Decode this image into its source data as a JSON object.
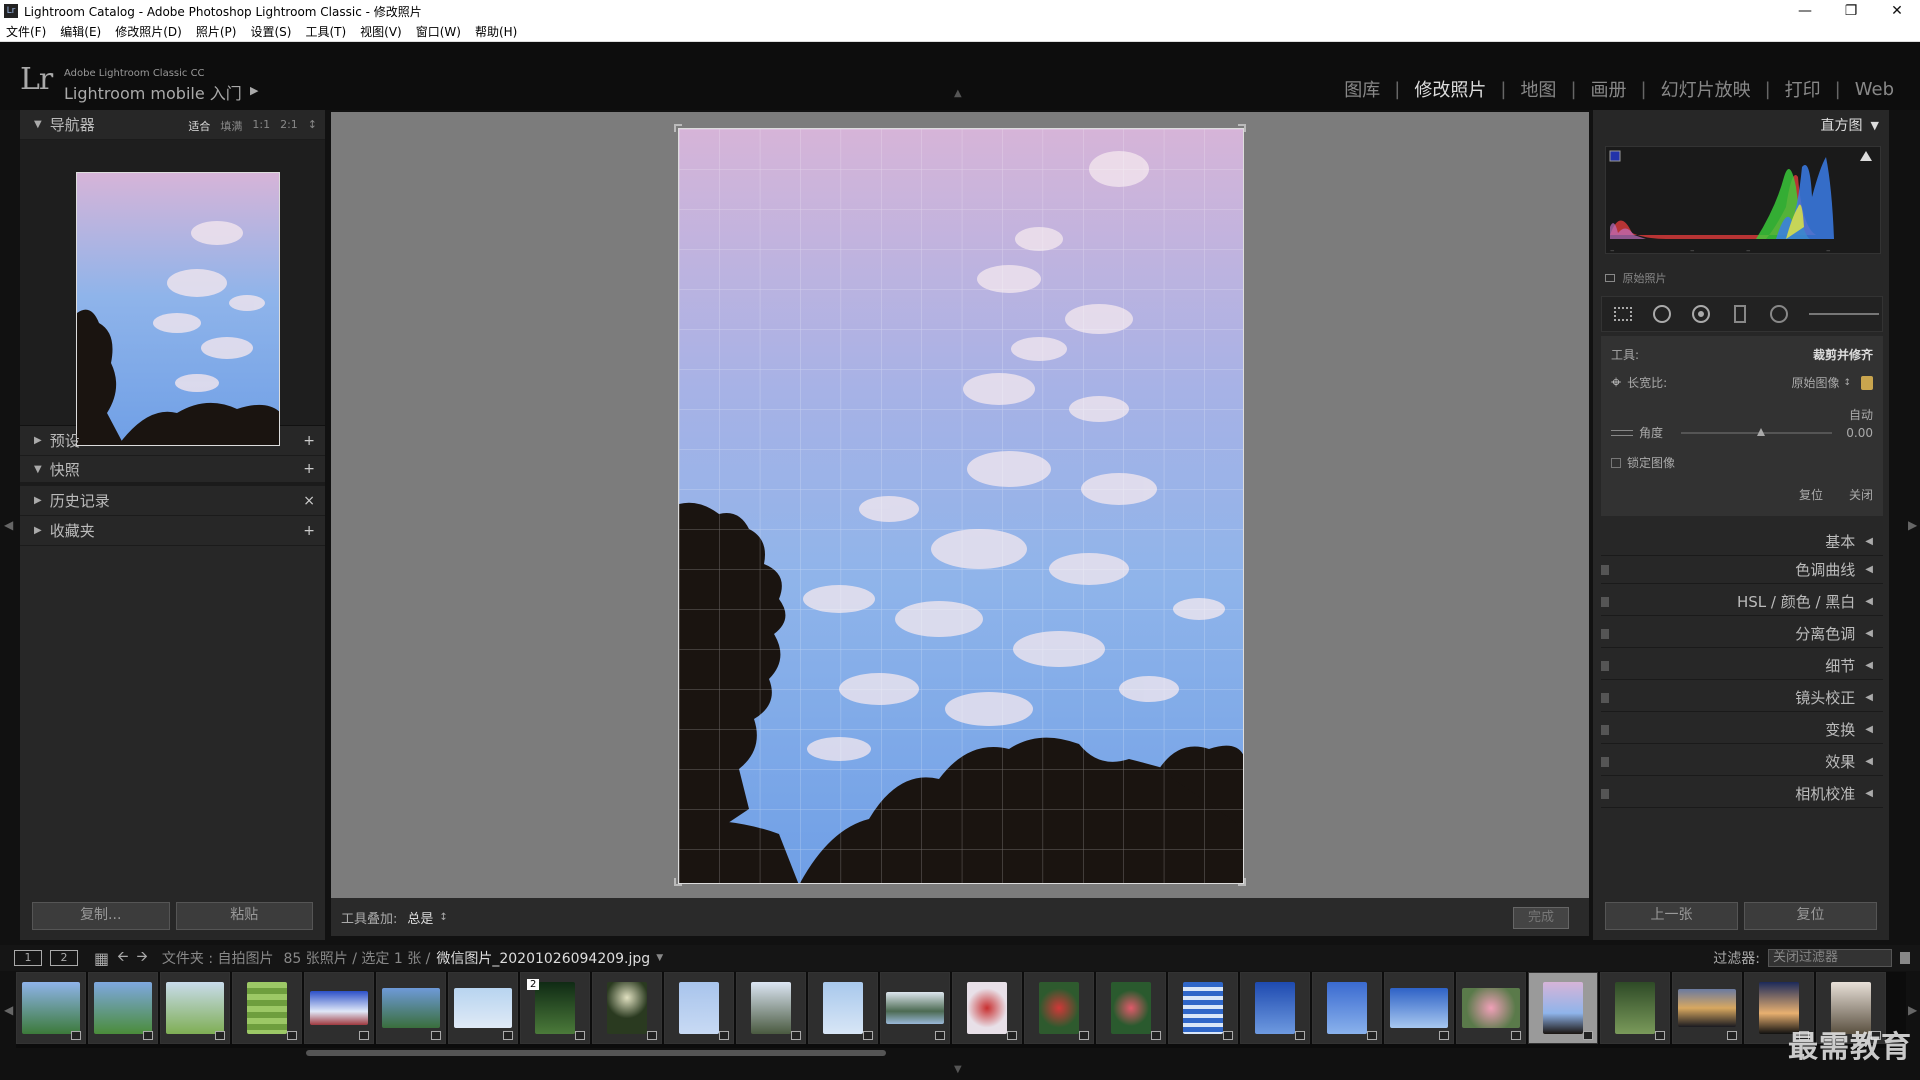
{
  "window": {
    "title": "Lightroom Catalog - Adobe Photoshop Lightroom Classic - 修改照片",
    "app_icon": "Lr"
  },
  "menu": [
    "文件(F)",
    "编辑(E)",
    "修改照片(D)",
    "照片(P)",
    "设置(S)",
    "工具(T)",
    "视图(V)",
    "窗口(W)",
    "帮助(H)"
  ],
  "identity": {
    "logo": "Lr",
    "small": "Adobe Lightroom Classic CC",
    "big": "Lightroom mobile 入门"
  },
  "modules": [
    {
      "label": "图库",
      "active": false
    },
    {
      "label": "修改照片",
      "active": true
    },
    {
      "label": "地图",
      "active": false
    },
    {
      "label": "画册",
      "active": false
    },
    {
      "label": "幻灯片放映",
      "active": false
    },
    {
      "label": "打印",
      "active": false
    },
    {
      "label": "Web",
      "active": false
    }
  ],
  "left": {
    "navigator": {
      "title": "导航器",
      "zoom": [
        "适合",
        "填满",
        "1:1",
        "2:1"
      ]
    },
    "panels": [
      {
        "title": "预设",
        "action": "+"
      },
      {
        "title": "快照",
        "action": "+"
      },
      {
        "title": "历史记录",
        "action": "×"
      },
      {
        "title": "收藏夹",
        "action": "+"
      }
    ],
    "buttons": {
      "copy": "复制...",
      "paste": "粘贴"
    }
  },
  "toolbar": {
    "label": "工具叠加:",
    "value": "总是",
    "done": "完成"
  },
  "right": {
    "histogram_title": "直方图",
    "original_photo": "原始照片",
    "crop": {
      "tool_label": "工具:",
      "tool_name": "裁剪并修齐",
      "aspect_label": "长宽比:",
      "aspect_value": "原始图像",
      "auto": "自动",
      "angle_label": "角度",
      "angle_value": "0.00",
      "constrain": "锁定图像",
      "reset": "复位",
      "close": "关闭"
    },
    "sections": [
      "基本",
      "色调曲线",
      "HSL / 颜色 / 黑白",
      "分离色调",
      "细节",
      "镜头校正",
      "变换",
      "效果",
      "相机校准"
    ],
    "buttons": {
      "previous": "上一张",
      "reset": "复位"
    }
  },
  "filmbar": {
    "pages": [
      "1",
      "2"
    ],
    "source": "文件夹 : 自拍图片",
    "count": "85 张照片 / 选定 1 张 /",
    "filename": "微信图片_20201026094209.jpg",
    "filter_label": "过滤器:",
    "filter_value": "关闭过滤器"
  },
  "thumbnail_stack_count": "2",
  "watermark": "最需教育",
  "colors": {
    "sky_top": "#d6b4d8",
    "sky_mid": "#8fb4ea",
    "sky_bottom": "#6f9fe6",
    "tree": "#1a1410",
    "panel_bg": "#272727",
    "canvas_bg": "#7c7c7c"
  }
}
